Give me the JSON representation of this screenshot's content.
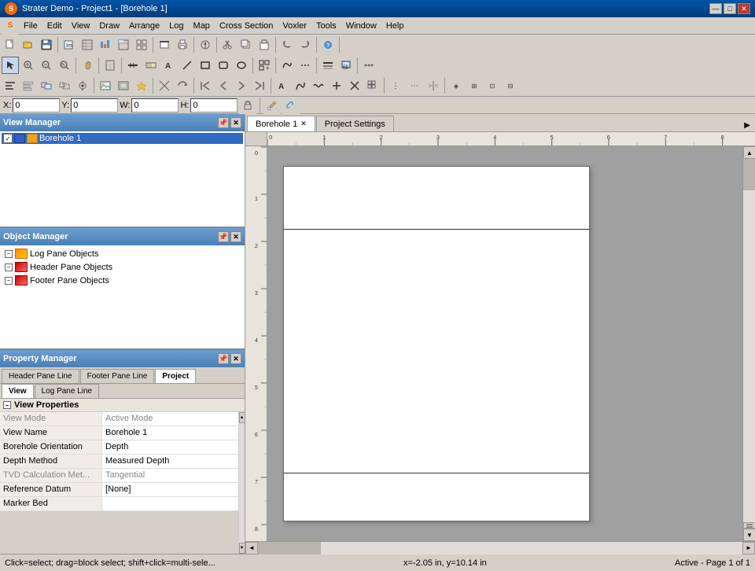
{
  "window": {
    "title": "Strater Demo - Project1 - [Borehole 1]",
    "icon": "S"
  },
  "titlebar": {
    "min_btn": "—",
    "max_btn": "□",
    "close_btn": "✕"
  },
  "menubar": {
    "items": [
      "File",
      "Edit",
      "View",
      "Draw",
      "Arrange",
      "Log",
      "Map",
      "Cross Section",
      "Voxler",
      "Tools",
      "Window",
      "Help"
    ]
  },
  "coords": {
    "x_label": "X:",
    "x_value": "0",
    "y_label": "Y:",
    "y_value": "0",
    "w_label": "W:",
    "w_value": "0",
    "h_label": "H:",
    "h_value": "0"
  },
  "view_manager": {
    "title": "View Manager",
    "items": [
      {
        "label": "Borehole 1",
        "checked": true,
        "selected": true
      }
    ]
  },
  "object_manager": {
    "title": "Object Manager",
    "items": [
      {
        "label": "Log Pane Objects",
        "icon": "log"
      },
      {
        "label": "Header Pane Objects",
        "icon": "header"
      },
      {
        "label": "Footer Pane Objects",
        "icon": "footer"
      }
    ]
  },
  "property_manager": {
    "title": "Property Manager",
    "tabs_row1": [
      "Header Pane Line",
      "Footer Pane Line",
      "Project"
    ],
    "tabs_row2": [
      "View",
      "Log Pane Line"
    ],
    "active_tab_r1": "Project",
    "active_tab_r2": "View",
    "section_title": "View Properties",
    "properties": [
      {
        "key": "View Mode",
        "value": "Active Mode",
        "disabled": true
      },
      {
        "key": "View Name",
        "value": "Borehole 1",
        "disabled": false
      },
      {
        "key": "Borehole Orientation",
        "value": "Depth",
        "disabled": false
      },
      {
        "key": "Depth Method",
        "value": "Measured Depth",
        "disabled": false
      },
      {
        "key": "TVD Calculation Met...",
        "value": "Tangential",
        "disabled": true
      },
      {
        "key": "Reference Datum",
        "value": "[None]",
        "disabled": false
      },
      {
        "key": "Marker Bed",
        "value": "",
        "disabled": false
      }
    ]
  },
  "tabs": [
    {
      "label": "Borehole 1",
      "active": true,
      "closable": true
    },
    {
      "label": "Project Settings",
      "active": false,
      "closable": false
    }
  ],
  "statusbar": {
    "left": "Click=select; drag=block select; shift+click=multi-sele...",
    "center": "x=-2.05 in, y=10.14 in",
    "right": "Active - Page 1 of 1"
  }
}
